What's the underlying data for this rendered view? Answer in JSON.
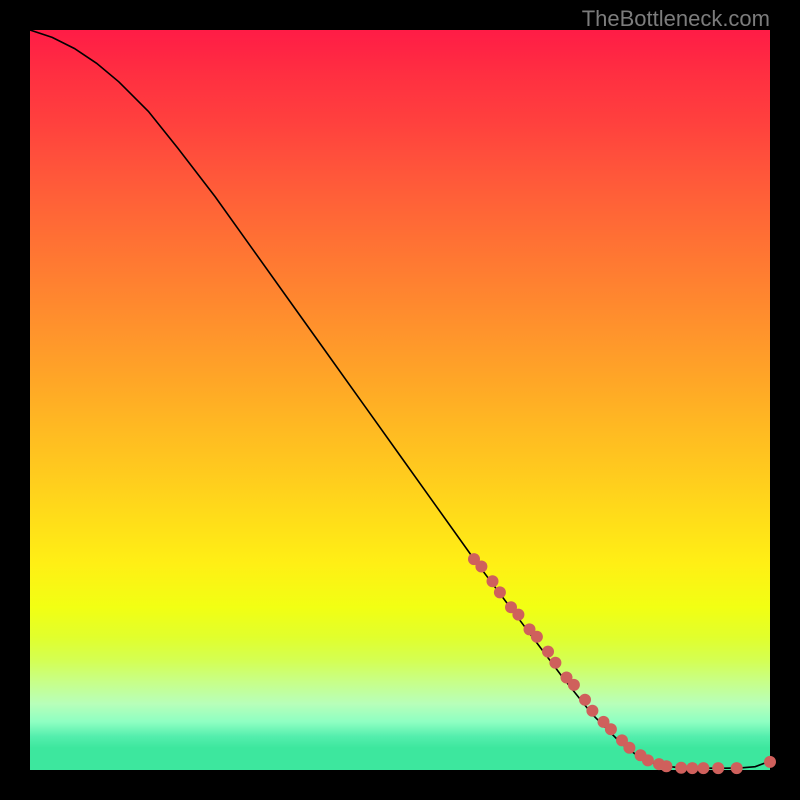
{
  "attribution": "TheBottleneck.com",
  "colors": {
    "dot": "#cf605c",
    "line": "#000000"
  },
  "chart_data": {
    "type": "line",
    "notes": "Axes are unlabeled in the source image; values are normalized to [0,100] on both axes by visual estimation.",
    "x_range": [
      0,
      100
    ],
    "y_range": [
      0,
      100
    ],
    "series": [
      {
        "name": "curve",
        "style": "line",
        "x": [
          0,
          3,
          6,
          9,
          12,
          16,
          20,
          25,
          30,
          35,
          40,
          45,
          50,
          55,
          60,
          63,
          66,
          69,
          72,
          74,
          76,
          78,
          80,
          82,
          84,
          86,
          88,
          90,
          92,
          94,
          96,
          98,
          100
        ],
        "y": [
          100,
          99,
          97.5,
          95.5,
          93,
          89,
          84,
          77.5,
          70.5,
          63.5,
          56.5,
          49.5,
          42.5,
          35.5,
          28.5,
          24.5,
          20.5,
          16.5,
          12.5,
          10,
          7.5,
          5.5,
          3.5,
          2.0,
          1.0,
          0.5,
          0.3,
          0.25,
          0.25,
          0.25,
          0.28,
          0.45,
          1.2
        ]
      },
      {
        "name": "highlight-dots",
        "style": "scatter",
        "x": [
          60,
          61,
          62.5,
          63.5,
          65,
          66,
          67.5,
          68.5,
          70,
          71,
          72.5,
          73.5,
          75,
          76,
          77.5,
          78.5,
          80,
          81,
          82.5,
          83.5,
          85,
          86,
          88,
          89.5,
          91,
          93,
          95.5,
          100
        ],
        "y": [
          28.5,
          27.5,
          25.5,
          24,
          22,
          21,
          19,
          18,
          16,
          14.5,
          12.5,
          11.5,
          9.5,
          8,
          6.5,
          5.5,
          4,
          3,
          2,
          1.3,
          0.8,
          0.5,
          0.3,
          0.25,
          0.25,
          0.25,
          0.25,
          1.1
        ]
      }
    ]
  }
}
